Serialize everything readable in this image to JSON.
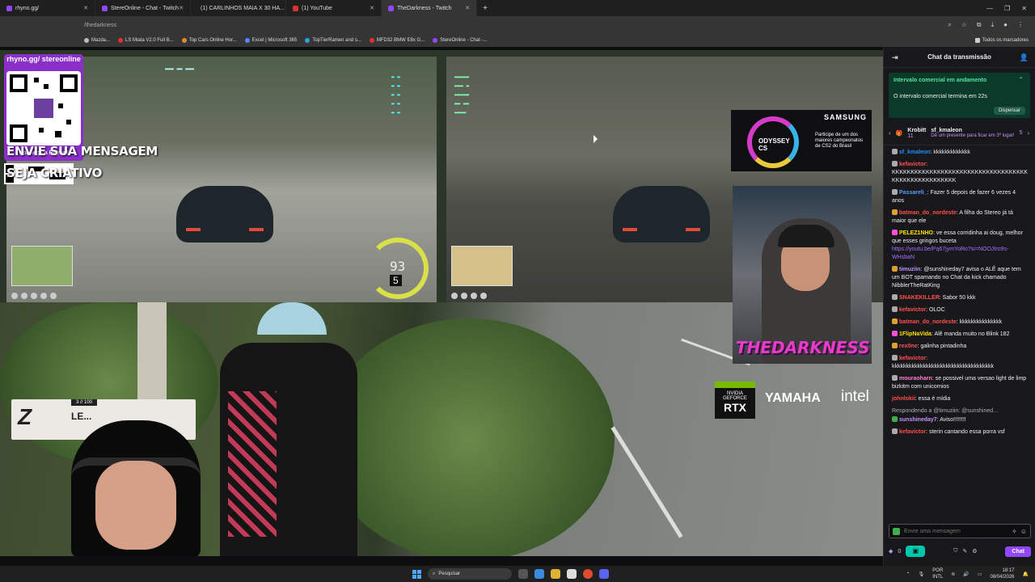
{
  "browser": {
    "tabs": [
      {
        "label": "rhyno.gg/",
        "color": "#9147ff"
      },
      {
        "label": "StereOnline - Chat - Twitch",
        "color": "#9147ff"
      },
      {
        "label": "(1) CARLINHOS MAIA X 30 HA...",
        "color": "#e03030"
      },
      {
        "label": "(1) YouTube",
        "color": "#e03030"
      },
      {
        "label": "TheDarkness - Twitch",
        "color": "#9147ff"
      }
    ],
    "address": "/thedarkness",
    "bookmarks": [
      {
        "label": "Mazda...",
        "color": "#bbb"
      },
      {
        "label": "LS Miata V2.0 Full B...",
        "color": "#e03030"
      },
      {
        "label": "Top Cars Online Hor...",
        "color": "#e08a30"
      },
      {
        "label": "Excel | Microsoft 365",
        "color": "#4f8aff"
      },
      {
        "label": "TopTierRamen and s...",
        "color": "#30a0e0"
      },
      {
        "label": "MFD32 BMW E8x G...",
        "color": "#e03030"
      },
      {
        "label": "StereOnline - Chat -...",
        "color": "#9147ff"
      }
    ],
    "bookmarks_all": "Todos os marcadores"
  },
  "stream": {
    "qr_title": "rhyno.gg/ stereonline",
    "qr_caption": "Conheça a Rhyno!",
    "overlay_message_line1": "ENVIE SUA MENSAGEM",
    "overlay_message_line2": "SEJA CRIATIVO",
    "speed": "93",
    "gear": "5",
    "ad_brand": "SAMSUNG",
    "ad_logo": "ODYSSEY CS",
    "ad_text": "Participe de um dos maiores campeonatos de CS2 do Brasil",
    "streamer_logo": "THEDARKNESS",
    "sponsor_nvidia": "NVIDIA GEFORCE",
    "sponsor_rtx": "RTX",
    "sponsor_yamaha": "YAMAHA",
    "sponsor_intel": "intel",
    "level_header": "3 // 100",
    "level_text": "LE..."
  },
  "chat": {
    "header_title": "Chat da transmissão",
    "ad_title": "Intervalo comercial em andamento",
    "ad_desc": "O intervalo comercial termina em 22s",
    "ad_dismiss": "Dispensar",
    "gifters": [
      {
        "name": "Krobitt",
        "count": "11"
      },
      {
        "name": "sf_kmaleon",
        "count": "5"
      }
    ],
    "gift_msg": "Dê um presente para ficar em 3º lugar!",
    "messages": [
      {
        "user": "sf_kmaleon",
        "color": "#1e90ff",
        "badge": "#aaa",
        "text": ": kkkkkkkkkkkkk"
      },
      {
        "user": "kefavictor",
        "color": "#ff4f4f",
        "badge": "#aaa",
        "text": ": KKKKKKKKKKKKKKKKKKKKKKKKKKKKKKKKKKKKKKKKKKKKKKKKKKKKK"
      },
      {
        "user": "Passareli_",
        "color": "#5a9bff",
        "badge": "#aaa",
        "text": ": Fazer 5 depois de fazer 6 vezes 4 anos"
      },
      {
        "user": "batman_do_nordeste",
        "color": "#ff4f4f",
        "badge": "#e0a030",
        "text": ": A filha do Stereo já tá maior que ele"
      },
      {
        "user": "PELEZ1NHO",
        "color": "#ffe100",
        "badge": "#ff4fd8",
        "text": ": ve essa corridinha ai doug, melhor que esses gringos buceta",
        "link": "https://youtu.be/Pq67jymYoRo?si=NOOJtro9s-WHsbaN"
      },
      {
        "user": "timuziin",
        "color": "#bf94ff",
        "badge": "#e0a030",
        "text": ": @sunshineday7 avisa o ALÊ aque tem um BOT spamando no Chat da kick chamado NibblerTheRatKing"
      },
      {
        "user": "SNAKEKILLER",
        "color": "#ff4f4f",
        "badge": "#aaa",
        "text": ": Sabor 50 kkk"
      },
      {
        "user": "kefavictor",
        "color": "#ff4f4f",
        "badge": "#aaa",
        "text": ": OLOC"
      },
      {
        "user": "batman_do_nordeste",
        "color": "#ff4f4f",
        "badge": "#e0a030",
        "text": ": kkkkkkkkkkkkkkk"
      },
      {
        "user": "1FlipNaVida",
        "color": "#ffe100",
        "badge": "#ff4fd8",
        "text": ": Alê manda muito no Blink 182"
      },
      {
        "user": "rex0ne",
        "color": "#ff4f4f",
        "badge": "#e0a030",
        "text": ": galinha pintadinha"
      },
      {
        "user": "kefavictor",
        "color": "#ff4f4f",
        "badge": "#aaa",
        "text": ": kkkkkkkkkkkkkkkkkkkkkkkkkkkkkkkkkkkk"
      },
      {
        "user": "mouraoharn",
        "color": "#ff7fd0",
        "badge": "#aaa",
        "text": ": se possivel uma versao light de limp bizkitm com unicornios"
      },
      {
        "user": "johnlokii",
        "color": "#ff4f4f",
        "badge": "",
        "text": ": essa é mídia"
      }
    ],
    "reply_to": "Respondendo a @timuziin: @sunshined...",
    "reply_msg": {
      "user": "sunshineday7",
      "color": "#bf94ff",
      "badge": "#3fae4a",
      "text": ": Aviso!!!!!!!!"
    },
    "last_msg": {
      "user": "kefavictor",
      "color": "#ff4f4f",
      "badge": "#aaa",
      "text": ": sterin cantando essa porra vsf"
    },
    "input_placeholder": "Envie uma mensagem",
    "points": "0",
    "chat_button": "Chat"
  },
  "taskbar": {
    "search": "Pesquisar",
    "lang1": "POR",
    "lang2": "INTL",
    "time": "18:17",
    "date": "08/04/2026"
  }
}
